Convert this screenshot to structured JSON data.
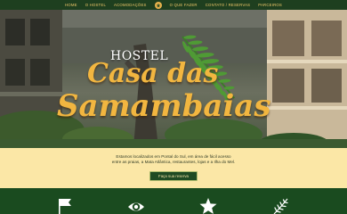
{
  "nav": {
    "items": [
      "HOME",
      "O HOSTEL",
      "ACOMODAÇÕES",
      "O QUE FAZER",
      "CONTATO / RESERVAS",
      "PARCEIROS"
    ],
    "logo_icon": "hostel-logo-icon"
  },
  "hero": {
    "hostel_label": "HOSTEL",
    "title_line1": "Casa das",
    "title_line2": "Samambaias",
    "title_color": "#f2b640"
  },
  "info": {
    "line1": "Estamos localizados em Pontal do Sul, em área de fácil acesso",
    "line2": "entre as praias, a Mata Atlântica, restaurantes, lojas e a Ilha do Mel.",
    "button_label": "Faça sua reserva"
  },
  "features": {
    "icons": [
      "flag-icon",
      "eye-icon",
      "star-icon",
      "fern-leaf-icon"
    ],
    "background": "#1a4b1f"
  }
}
